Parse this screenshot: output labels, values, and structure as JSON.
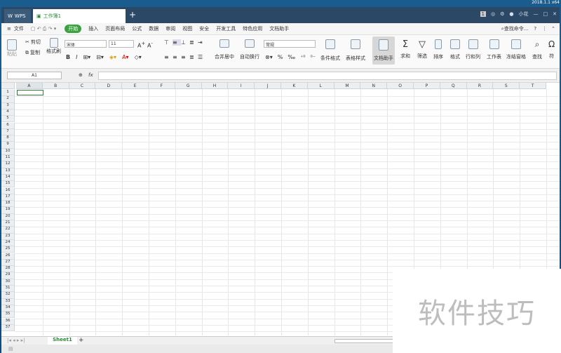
{
  "version": "2018.1.1 x64",
  "titlebar": {
    "app_tab": "WPS",
    "doc_tab": "工作簿1",
    "new_tab": "+",
    "user": "小花"
  },
  "menu": {
    "file": "文件",
    "items": [
      "开始",
      "插入",
      "页面布局",
      "公式",
      "数据",
      "审阅",
      "视图",
      "安全",
      "开发工具",
      "特色应用",
      "文档助手"
    ],
    "search": "查找命令...",
    "help": "?"
  },
  "ribbon": {
    "paste": "粘贴",
    "cut": "剪切",
    "copy": "复制",
    "format_painter": "格式刷",
    "font": "宋体",
    "size": "11",
    "merge": "合并居中",
    "wrap": "自动换行",
    "number_format": "常规",
    "cond_format": "条件格式",
    "table_style": "表格样式",
    "doc_helper": "文档助手",
    "sum": "求和",
    "filter": "筛选",
    "sort": "排序",
    "format": "格式",
    "row_col": "行和列",
    "sheet": "工作表",
    "freeze": "冻结窗格",
    "find": "查找",
    "symbol": "符"
  },
  "formula": {
    "cell": "A1",
    "fx": "fx"
  },
  "columns": [
    "A",
    "B",
    "C",
    "D",
    "E",
    "F",
    "G",
    "H",
    "I",
    "J",
    "K",
    "L",
    "M",
    "N",
    "O",
    "P",
    "Q",
    "R",
    "S",
    "T"
  ],
  "rows": [
    "1",
    "2",
    "3",
    "4",
    "5",
    "6",
    "7",
    "8",
    "9",
    "10",
    "11",
    "12",
    "13",
    "14",
    "15",
    "16",
    "17",
    "18",
    "19",
    "20",
    "21",
    "22",
    "23",
    "24",
    "25",
    "26",
    "27",
    "28",
    "29",
    "30",
    "31",
    "32",
    "33",
    "34",
    "35",
    "36",
    "37"
  ],
  "sheet": {
    "tab": "Sheet1",
    "add": "+"
  },
  "watermark": "软件技巧"
}
